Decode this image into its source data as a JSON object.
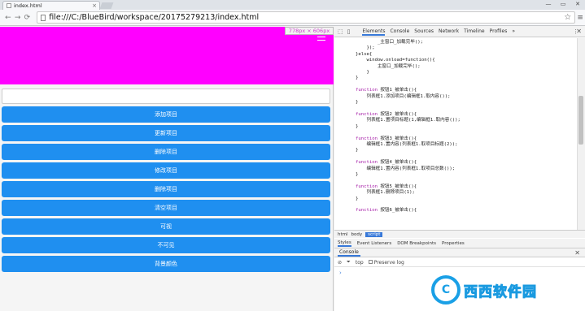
{
  "browser": {
    "tab_title": "index.html",
    "tab_close": "×",
    "window_controls": [
      "—",
      "▭",
      "✕"
    ],
    "nav": {
      "back": "←",
      "forward": "→",
      "reload": "⟳"
    },
    "url": "file:///C:/BlueBird/workspace/20175279213/index.html",
    "bookmark_icon": "☆",
    "menu_icon": "≡"
  },
  "page": {
    "banner_color": "#ff00ff",
    "size_badge": "778px × 606px",
    "buttons": [
      "添加项目",
      "更新项目",
      "删除项目",
      "修改项目",
      "删除项目",
      "清空项目",
      "可视",
      "不可见",
      "背景颜色"
    ]
  },
  "devtools": {
    "toolbar_icons": {
      "inspect": "⬚",
      "device": "▯"
    },
    "tabs": [
      "Elements",
      "Console",
      "Sources",
      "Network",
      "Timeline",
      "Profiles"
    ],
    "active_tab": "Elements",
    "more": "»",
    "menu": "⋮",
    "close": "✕",
    "code_lines": [
      "        _主窗口_加载完毕();",
      "    });",
      "}else{",
      "    window.onload=function(){",
      "        主窗口_加载完毕();",
      "    }",
      "}",
      "",
      "function 按钮1_被单击(){",
      "    列表框1.添加项目(编辑框1.取内容());",
      "}",
      "",
      "function 按钮2_被单击(){",
      "    列表框1.置项目标题(1,编辑框1.取内容());",
      "}",
      "",
      "function 按钮3_被单击(){",
      "    编辑框1.置内容(列表框1.取项目标题(2));",
      "}",
      "",
      "function 按钮4_被单击(){",
      "    编辑框1.置内容(列表框1.取项目总数());",
      "}",
      "",
      "function 按钮5_被单击(){",
      "    列表框1.删除项目(1);",
      "}",
      "",
      "function 按钮6_被单击(){"
    ],
    "breadcrumbs": [
      "html",
      "body",
      "script"
    ],
    "selected_crumb": "script",
    "subtabs": [
      "Styles",
      "Event Listeners",
      "DOM Breakpoints",
      "Properties"
    ],
    "active_subtab": "Styles",
    "console": {
      "title": "Console",
      "close": "✕",
      "clear_icon": "⊘",
      "filter_icon": "⏷",
      "context": "top",
      "preserve_log": "Preserve log",
      "prompt": "›"
    }
  },
  "watermark": {
    "text": "西西软件园",
    "logo_char": "C"
  }
}
